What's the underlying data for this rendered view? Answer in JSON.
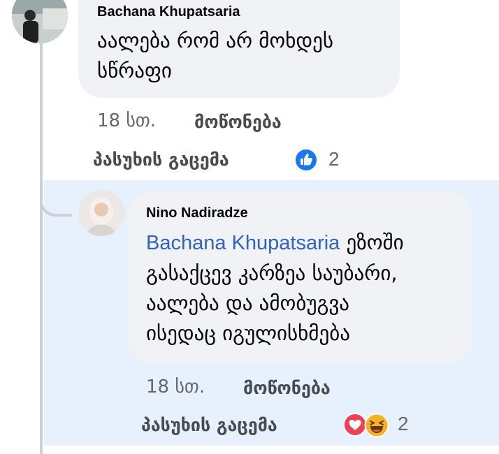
{
  "comments": [
    {
      "author": "Bachana Khupatsaria",
      "text_lines": [
        "აალება რომ არ მოხდეს",
        "სწრაფი"
      ],
      "time": "18 სთ.",
      "like_label": "მოწონება",
      "reply_label": "პასუხის გაცემა",
      "reactions": [
        "like-icon"
      ],
      "reaction_count": "2"
    },
    {
      "author": "Nino Nadiradze",
      "mention": "Bachana Khupatsaria",
      "first_line_rest": " ეზოში",
      "text_lines": [
        "გასაქცევ კარზეა საუბარი,",
        "აალება და ამობუგვა",
        "ისედაც იგულისხმება"
      ],
      "time": "18 სთ.",
      "like_label": "მოწონება",
      "reply_label": "პასუხის გაცემა",
      "reactions": [
        "love-icon",
        "haha-icon"
      ],
      "reaction_count": "2"
    }
  ],
  "colors": {
    "bubble": "#f0f2f5",
    "highlight": "#e7f1fd",
    "mention": "#2f62c7",
    "like_blue": "#1877f2",
    "love_red": "#f33e58",
    "haha_yellow": "#f7b125"
  }
}
